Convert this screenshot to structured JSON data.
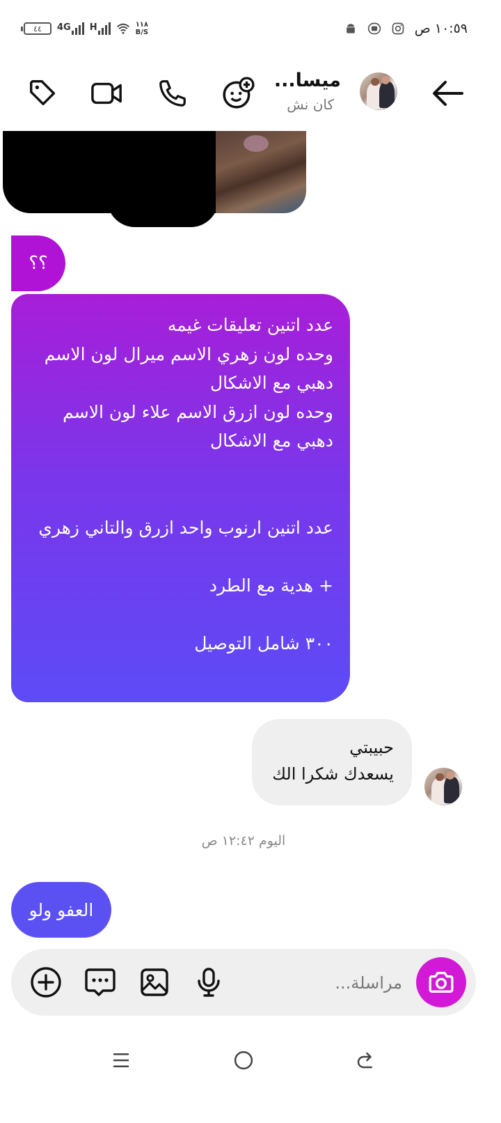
{
  "status_bar": {
    "battery": "٤٤",
    "network_1": "4G",
    "network_2": "H",
    "speed_value": "١١٨",
    "speed_unit": "B/S",
    "time": "١٠:٥٩ ص"
  },
  "header": {
    "contact_name": "ميسا...",
    "contact_status": "كان نش"
  },
  "messages": {
    "question": "؟؟",
    "long_order": "عدد اتنين تعليقات غيمه\nوحده لون زهري الاسم ميرال لون الاسم دهبي مع الاشكال\nوحده لون ازرق الاسم علاء لون الاسم دهبي مع الاشكال\n\n\nعدد اتنين ارنوب واحد ازرق والتاني زهري\n\n+ هدية مع الطرد\n\n٣٠٠ شامل التوصيل",
    "incoming_reply": "حبيبتي\nيسعدك شكرا الك",
    "timestamp": "اليوم ١٢:٤٢ ص",
    "last_sent": "العفو ولو"
  },
  "composer": {
    "placeholder": "مراسلة..."
  },
  "colors": {
    "accent_purple": "#b012d6",
    "gradient_top": "#a81ed8",
    "gradient_bottom": "#5d4bf7",
    "camera": "#d21ad6",
    "incoming_bg": "#efefef"
  },
  "icons": [
    "back-arrow-icon",
    "sticker-add-icon",
    "phone-icon",
    "video-icon",
    "tag-icon",
    "plus-circle-icon",
    "chat-options-icon",
    "gallery-icon",
    "microphone-icon",
    "camera-icon",
    "menu-icon",
    "home-circle-icon",
    "back-nav-icon"
  ]
}
